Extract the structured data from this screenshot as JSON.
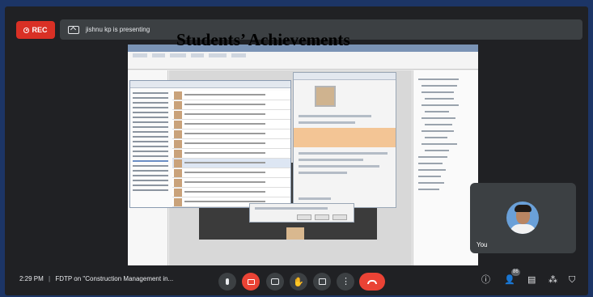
{
  "meet": {
    "rec_label": "REC",
    "presenting_text": "jishnu kp is presenting",
    "overlay_title": "Students’ Achievements",
    "self_tile_label": "You",
    "time": "2:29 PM",
    "separator": "|",
    "meeting_name": "FDTP on \"Construction Management in...",
    "participants_badge": "86",
    "icons": {
      "rec": "record-icon",
      "present": "present-screen-icon",
      "mic": "microphone-icon",
      "camera_off": "camera-off-icon",
      "captions": "captions-icon",
      "raise_hand": "raise-hand-icon",
      "present_now": "present-now-icon",
      "more": "more-options-icon",
      "end_call": "end-call-icon",
      "info": "info-icon",
      "people": "people-icon",
      "chat": "chat-icon",
      "activities": "activities-icon",
      "host_controls": "shield-icon"
    },
    "colors": {
      "background_outer": "#1c3566",
      "meet_background": "#202124",
      "bar": "#3c4043",
      "red": "#ea4335",
      "text": "#e8eaed"
    }
  }
}
